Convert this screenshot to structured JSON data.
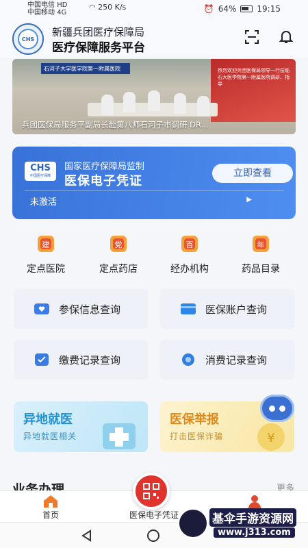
{
  "statusbar": {
    "carrier1": "中国电信",
    "carrier2": "中国移动",
    "network1": "HD",
    "network2": "4G",
    "speed_value": "250",
    "speed_unit": "K/s",
    "battery": "64%",
    "time": "19:15"
  },
  "header": {
    "org_name": "新疆兵团医疗保障局",
    "platform_name": "医疗保障服务平台",
    "logo_text": "CHS"
  },
  "banner": {
    "caption": "兵团医保局服务平副局长赴第八师石河子市调研 DR...",
    "sign_text": "石河子大学医学院第一附属医院",
    "screen_text": "热烈欢迎兵团医保局领导一行莅临 石大医学院第一附属医院调研、指导"
  },
  "insurance_card": {
    "logo_text": "CHS",
    "logo_sub": "中国医疗保障",
    "supervisor": "国家医疗保障局监制",
    "title": "医保电子凭证",
    "button_label": "立即查看",
    "status": "未激活"
  },
  "quick_actions": [
    {
      "label": "定点医院",
      "icon_char": "建"
    },
    {
      "label": "定点药店",
      "icon_char": "党"
    },
    {
      "label": "经办机构",
      "icon_char": "百"
    },
    {
      "label": "药品目录",
      "icon_char": "年"
    }
  ],
  "service_tiles": [
    {
      "label": "参保信息查询",
      "icon": "heart-card-icon",
      "color": "#3d7be6"
    },
    {
      "label": "医保账户查询",
      "icon": "card-icon",
      "color": "#2f86e8"
    },
    {
      "label": "缴费记录查询",
      "icon": "check-card-icon",
      "color": "#3a7be0"
    },
    {
      "label": "消费记录查询",
      "icon": "coin-icon",
      "color": "#2f7fe3"
    }
  ],
  "promos": [
    {
      "title": "异地就医",
      "subtitle": "异地就医相关"
    },
    {
      "title": "医保举报",
      "subtitle": "打击医保诈骗"
    }
  ],
  "section": {
    "title": "业务办理",
    "more": "更多"
  },
  "tabbar": {
    "home": "首页",
    "certificate": "医保电子凭证",
    "mine": "我的"
  },
  "watermark": {
    "title": "基伞手游资源网",
    "url": "www.j313.com"
  },
  "colors": {
    "brand_blue": "#3872d8",
    "accent_red": "#e0332e",
    "promo_blue": "#1f8fd2",
    "promo_orange": "#e0891b"
  }
}
